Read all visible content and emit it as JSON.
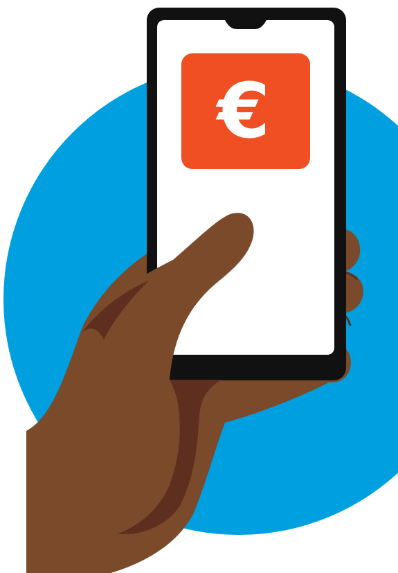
{
  "illustration": {
    "subject": "hand-holding-phone",
    "icons": {
      "phone": "smartphone-icon",
      "app": "euro-icon"
    },
    "app_icon_symbol": "€",
    "colors": {
      "background_circle": "#009FE0",
      "phone_body": "#111111",
      "phone_screen": "#FFFFFF",
      "app_tile": "#F04E23",
      "app_symbol": "#FFFFFF",
      "skin": "#7A4A2B",
      "skin_shadow": "#5E2F1E"
    }
  }
}
